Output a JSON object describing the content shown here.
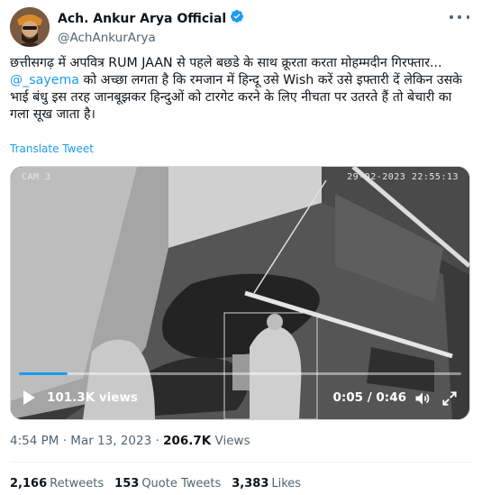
{
  "author": {
    "display_name": "Ach. Ankur Arya Official",
    "handle": "@AchAnkurArya",
    "verified": true
  },
  "tweet": {
    "line1": "छत्तीसगढ़ में अपवित्र RUM JAAN से पहले बछडे के साथ क्रूरता करता मोहम्मदीन गिरफ्तार...",
    "mention": "@_sayema",
    "line2": " को अच्छा लगता है कि रमजान में हिन्दू उसे Wish करें उसे इफ्तारी दें लेकिन उसके भाई बंधु इस तरह जानबूझकर हिन्दुओं को टारगेट करने के लिए नीचता पर उतरते हैं तो बेचारी का गला सूख जाता है।",
    "translate_label": "Translate Tweet"
  },
  "video": {
    "cam_label": "CAM 3",
    "timestamp": "29-02-2023 22:55:13",
    "views_label": "101.3K views",
    "time_label": "0:05 / 0:46",
    "progress": 0.11
  },
  "meta": {
    "time": "4:54 PM",
    "separator1": "·",
    "date": "Mar 13, 2023",
    "separator2": "·",
    "views_count": "206.7K",
    "views_word": "Views"
  },
  "stats": {
    "retweets_count": "2,166",
    "retweets_label": "Retweets",
    "quotes_count": "153",
    "quotes_label": "Quote Tweets",
    "likes_count": "3,383",
    "likes_label": "Likes"
  },
  "colors": {
    "accent": "#1d9bf0",
    "text": "#0f1419",
    "muted": "#536471"
  },
  "icons": [
    "verified-badge-icon",
    "more-options-icon",
    "play-icon",
    "volume-icon",
    "fullscreen-icon"
  ]
}
